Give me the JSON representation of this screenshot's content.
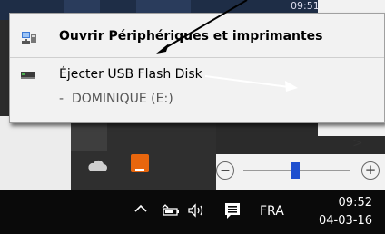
{
  "menu": {
    "devices_label": "Ouvrir Périphériques et imprimantes",
    "eject_label": "Éjecter USB Flash Disk",
    "drive_dash": "-",
    "drive_label": "DOMINIQUE (E:)"
  },
  "background": {
    "top_time_fragment": "09:51"
  },
  "zoom": {
    "minus": "−",
    "plus": "+",
    "scroll_arrow": ">",
    "level": 0.5
  },
  "taskbar": {
    "language": "FRA",
    "time": "09:52",
    "date": "04-03-16"
  },
  "annotations": {
    "arrow_color_black": "#000000",
    "arrow_color_white": "#ffffff"
  },
  "colors": {
    "menu_bg": "#f2f2f2",
    "taskbar_bg": "#0a0a0a",
    "accent": "#1e4fcf"
  }
}
